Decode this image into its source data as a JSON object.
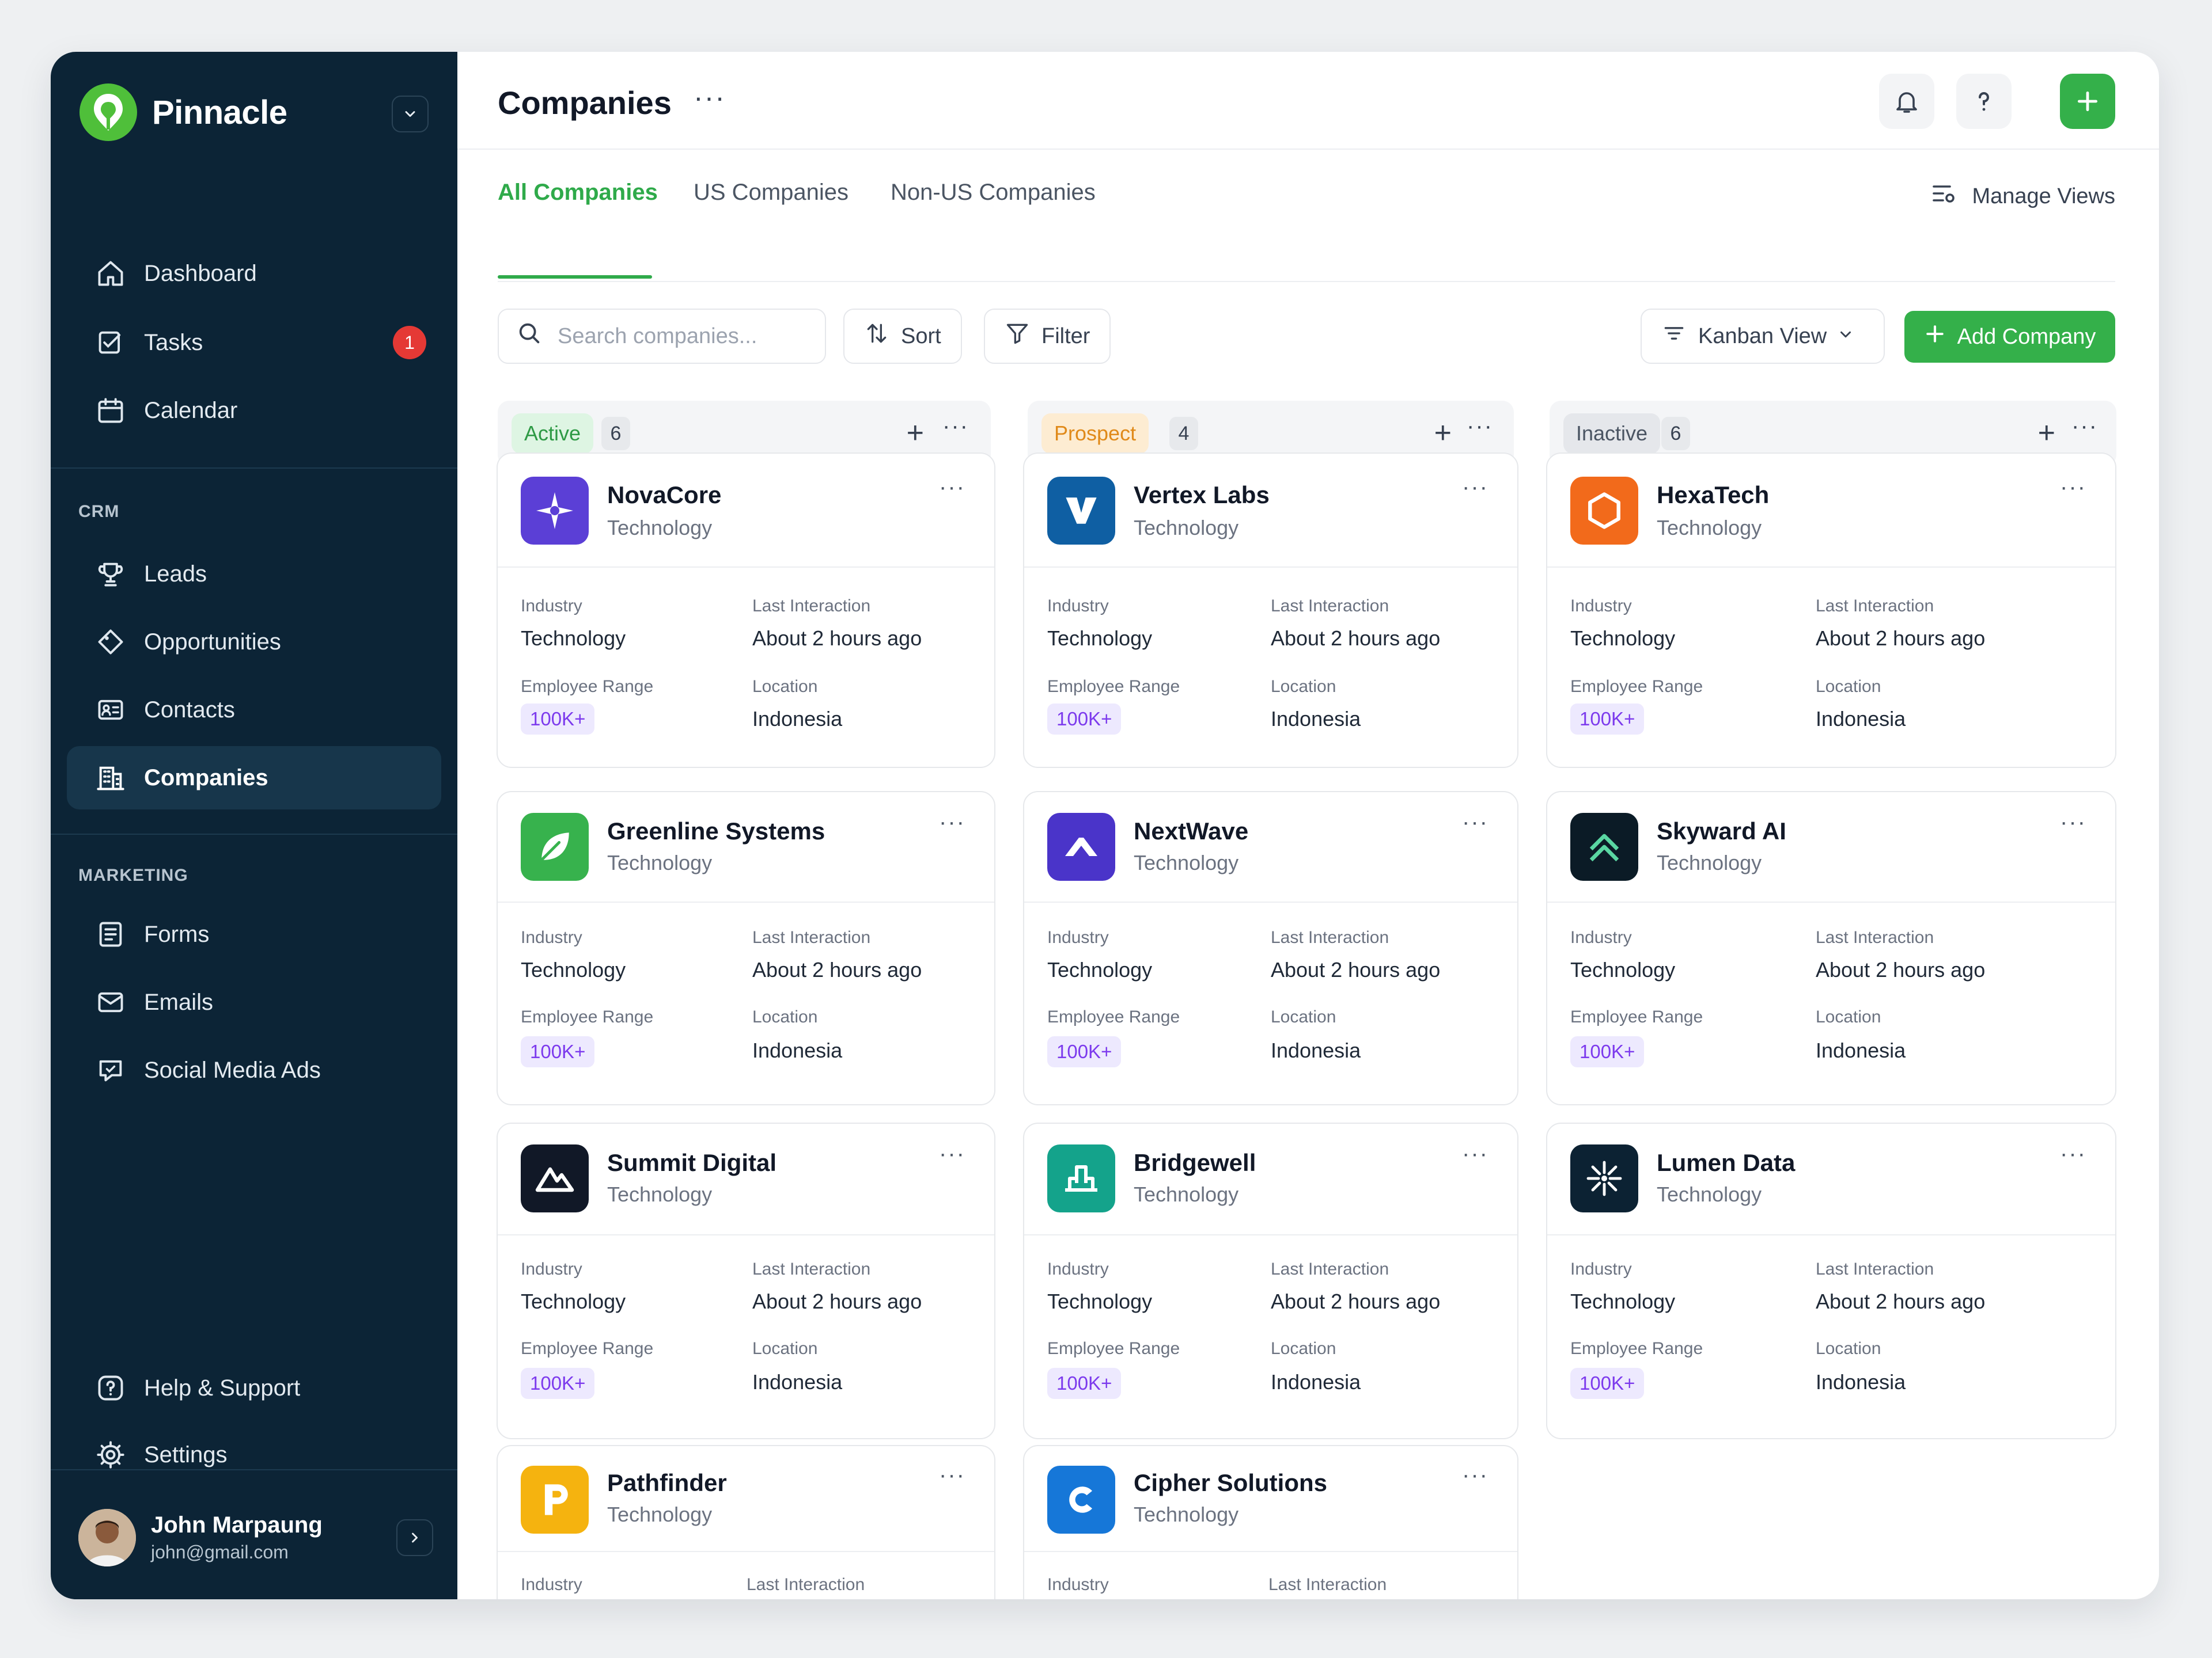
{
  "brand": {
    "name": "Pinnacle"
  },
  "sidebar": {
    "nav": [
      {
        "label": "Dashboard"
      },
      {
        "label": "Tasks",
        "badge": "1"
      },
      {
        "label": "Calendar"
      }
    ],
    "crm_label": "CRM",
    "crm": [
      {
        "label": "Leads"
      },
      {
        "label": "Opportunities"
      },
      {
        "label": "Contacts"
      },
      {
        "label": "Companies",
        "active": true
      }
    ],
    "marketing_label": "MARKETING",
    "marketing": [
      {
        "label": "Forms"
      },
      {
        "label": "Emails"
      },
      {
        "label": "Social Media Ads"
      }
    ],
    "bottom": [
      {
        "label": "Help & Support"
      },
      {
        "label": "Settings"
      }
    ],
    "user": {
      "name": "John Marpaung",
      "email": "john@gmail.com"
    }
  },
  "header": {
    "title": "Companies",
    "more": "···"
  },
  "tabs": [
    {
      "label": "All Companies",
      "active": true
    },
    {
      "label": "US Companies"
    },
    {
      "label": "Non-US Companies"
    }
  ],
  "manage_views": "Manage Views",
  "toolbar": {
    "search_placeholder": "Search companies...",
    "sort": "Sort",
    "filter": "Filter",
    "view": "Kanban View",
    "add": "Add Company"
  },
  "colors": {
    "accent": "#34b04a",
    "sidebar": "#0c2436"
  },
  "columns": [
    {
      "status": "Active",
      "count": "6"
    },
    {
      "status": "Prospect",
      "count": "4"
    },
    {
      "status": "Inactive",
      "count": "6"
    }
  ],
  "field_labels": {
    "industry": "Industry",
    "last_interaction": "Last Interaction",
    "employee_range": "Employee Range",
    "location": "Location"
  },
  "cards": [
    {
      "name": "NovaCore",
      "sub": "Technology",
      "industry": "Technology",
      "last": "About 2 hours ago",
      "range": "100K+",
      "location": "Indonesia"
    },
    {
      "name": "Vertex Labs",
      "sub": "Technology",
      "industry": "Technology",
      "last": "About 2 hours ago",
      "range": "100K+",
      "location": "Indonesia"
    },
    {
      "name": "HexaTech",
      "sub": "Technology",
      "industry": "Technology",
      "last": "About 2 hours ago",
      "range": "100K+",
      "location": "Indonesia"
    },
    {
      "name": "Greenline Systems",
      "sub": "Technology",
      "industry": "Technology",
      "last": "About 2 hours ago",
      "range": "100K+",
      "location": "Indonesia"
    },
    {
      "name": "NextWave",
      "sub": "Technology",
      "industry": "Technology",
      "last": "About 2 hours ago",
      "range": "100K+",
      "location": "Indonesia"
    },
    {
      "name": "Skyward AI",
      "sub": "Technology",
      "industry": "Technology",
      "last": "About 2 hours ago",
      "range": "100K+",
      "location": "Indonesia"
    },
    {
      "name": "Summit Digital",
      "sub": "Technology",
      "industry": "Technology",
      "last": "About 2 hours ago",
      "range": "100K+",
      "location": "Indonesia"
    },
    {
      "name": "Bridgewell",
      "sub": "Technology",
      "industry": "Technology",
      "last": "About 2 hours ago",
      "range": "100K+",
      "location": "Indonesia"
    },
    {
      "name": "Lumen Data",
      "sub": "Technology",
      "industry": "Technology",
      "last": "About 2 hours ago",
      "range": "100K+",
      "location": "Indonesia"
    },
    {
      "name": "Pathfinder",
      "sub": "Technology"
    },
    {
      "name": "Cipher Solutions",
      "sub": "Technology"
    }
  ]
}
